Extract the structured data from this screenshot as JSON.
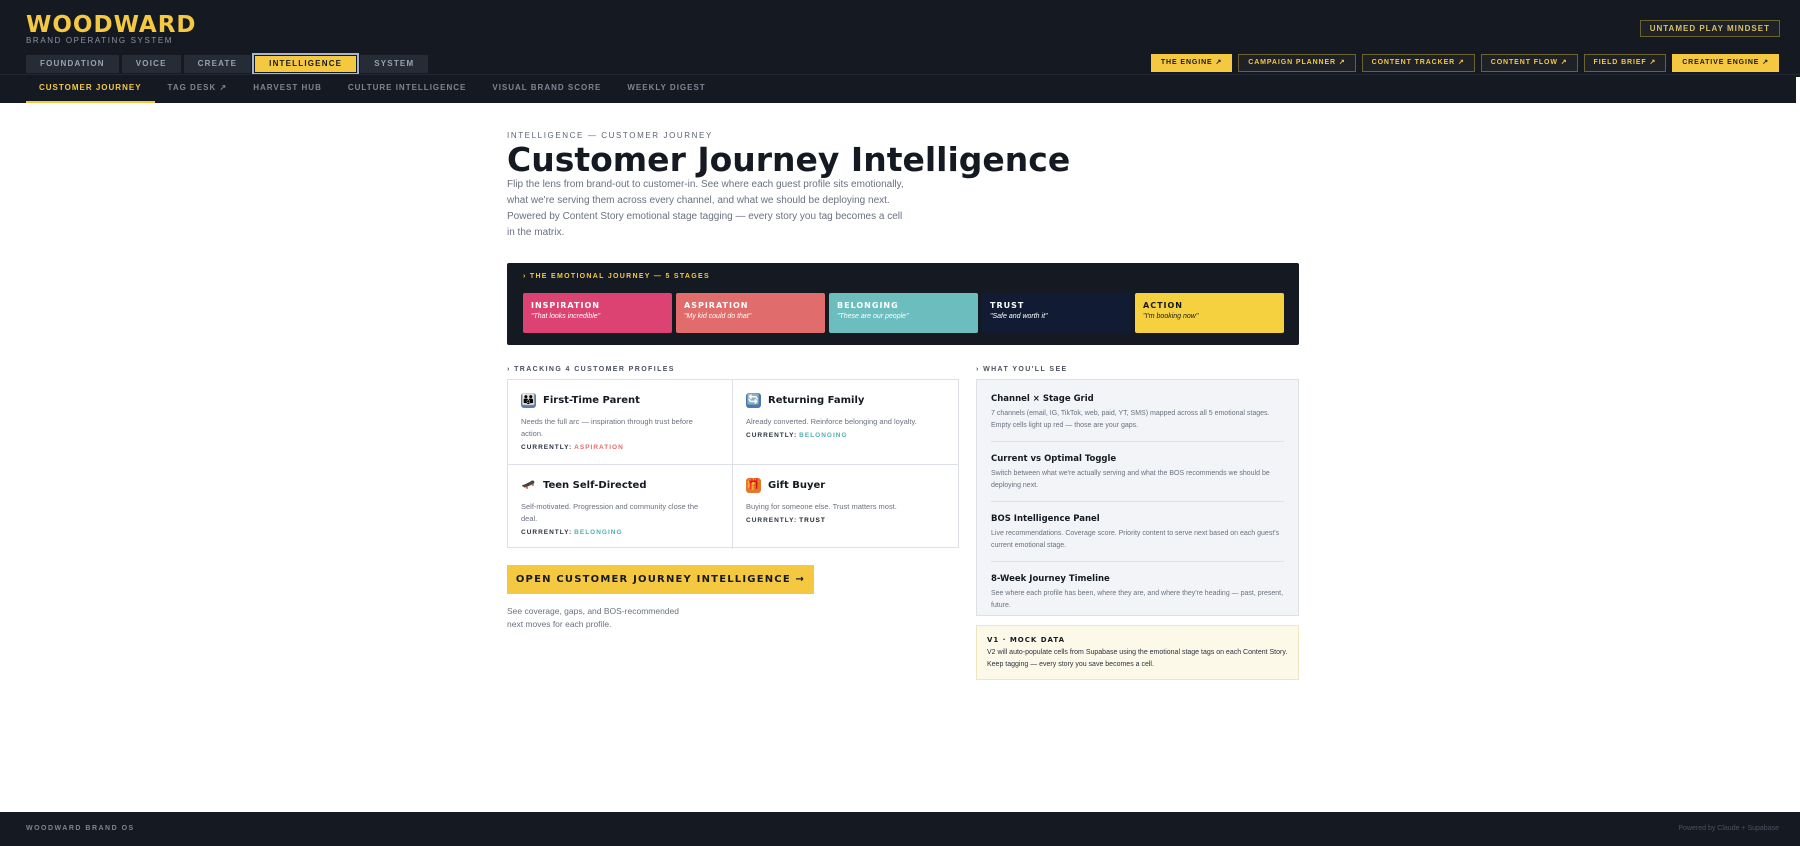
{
  "brand": {
    "name": "WOODWARD",
    "subtitle": "BRAND OPERATING SYSTEM"
  },
  "header": {
    "mindset_button": "UNTAMED PLAY MINDSET",
    "main_tabs": [
      "FOUNDATION",
      "VOICE",
      "CREATE",
      "INTELLIGENCE",
      "SYSTEM"
    ],
    "active_main_tab": "INTELLIGENCE",
    "tools": [
      "THE ENGINE ↗",
      "CAMPAIGN PLANNER ↗",
      "CONTENT TRACKER ↗",
      "CONTENT FLOW ↗",
      "FIELD BRIEF ↗",
      "CREATIVE ENGINE ↗"
    ]
  },
  "subnav": {
    "items": [
      "CUSTOMER JOURNEY",
      "TAG DESK ↗",
      "HARVEST HUB",
      "CULTURE INTELLIGENCE",
      "VISUAL BRAND SCORE",
      "WEEKLY DIGEST"
    ],
    "active": "CUSTOMER JOURNEY"
  },
  "page": {
    "eyebrow": "INTELLIGENCE — CUSTOMER JOURNEY",
    "title": "Customer Journey Intelligence",
    "description": "Flip the lens from brand-out to customer-in. See where each guest profile sits emotionally, what we're serving them across every channel, and what we should be deploying next. Powered by Content Story emotional stage tagging — every story you tag becomes a cell in the matrix."
  },
  "journey": {
    "label": "› THE EMOTIONAL JOURNEY — 5 STAGES",
    "stages": [
      {
        "name": "INSPIRATION",
        "quote": "\"That looks incredible\"",
        "color": "#dc4373",
        "text_color": "#ffffff"
      },
      {
        "name": "ASPIRATION",
        "quote": "\"My kid could do that\"",
        "color": "#e06c6b",
        "text_color": "#ffffff"
      },
      {
        "name": "BELONGING",
        "quote": "\"These are our people\"",
        "color": "#6cbdbe",
        "text_color": "#ffffff"
      },
      {
        "name": "TRUST",
        "quote": "\"Safe and worth it\"",
        "color": "#111b33",
        "text_color": "#ffffff"
      },
      {
        "name": "ACTION",
        "quote": "\"I'm booking now\"",
        "color": "#f5d13f",
        "text_color": "#151a22"
      }
    ]
  },
  "profiles_section": {
    "label": "› TRACKING 4 CUSTOMER PROFILES",
    "currently_label": "CURRENTLY:",
    "profiles": [
      {
        "icon": "family-icon",
        "glyph": "👪",
        "icon_bg": "#5b7cb0",
        "name": "First-Time Parent",
        "desc": "Needs the full arc — inspiration through trust before action.",
        "stage": "ASPIRATION",
        "stage_color": "#e06c6b"
      },
      {
        "icon": "loop-icon",
        "glyph": "🔄",
        "icon_bg": "#4a78b8",
        "name": "Returning Family",
        "desc": "Already converted. Reinforce belonging and loyalty.",
        "stage": "BELONGING",
        "stage_color": "#4fb0b3"
      },
      {
        "icon": "skateboard-icon",
        "glyph": "🛹",
        "icon_bg": "#ffffff",
        "name": "Teen Self-Directed",
        "desc": "Self-motivated. Progression and community close the deal.",
        "stage": "BELONGING",
        "stage_color": "#4fb0b3"
      },
      {
        "icon": "gift-icon",
        "glyph": "🎁",
        "icon_bg": "#e0792b",
        "name": "Gift Buyer",
        "desc": "Buying for someone else. Trust matters most.",
        "stage": "TRUST",
        "stage_color": "#151a22"
      }
    ]
  },
  "cta": {
    "label": "OPEN CUSTOMER JOURNEY INTELLIGENCE →",
    "note": "See coverage, gaps, and BOS-recommended next moves for each profile."
  },
  "see_section": {
    "label": "› WHAT YOU'LL SEE",
    "items": [
      {
        "title": "Channel × Stage Grid",
        "desc": "7 channels (email, IG, TikTok, web, paid, YT, SMS) mapped across all 5 emotional stages. Empty cells light up red — those are your gaps."
      },
      {
        "title": "Current vs Optimal Toggle",
        "desc": "Switch between what we're actually serving and what the BOS recommends we should be deploying next."
      },
      {
        "title": "BOS Intelligence Panel",
        "desc": "Live recommendations. Coverage score. Priority content to serve next based on each guest's current emotional stage."
      },
      {
        "title": "8-Week Journey Timeline",
        "desc": "See where each profile has been, where they are, and where they're heading — past, present, future."
      }
    ]
  },
  "mock": {
    "title": "V1 · MOCK DATA",
    "desc": "V2 will auto-populate cells from Supabase using the emotional stage tags on each Content Story. Keep tagging — every story you save becomes a cell."
  },
  "footer": {
    "left": "WOODWARD BRAND OS",
    "right": "Powered by Claude + Supabase"
  },
  "colors": {
    "dark": "#151a22",
    "accent": "#f5c842"
  }
}
